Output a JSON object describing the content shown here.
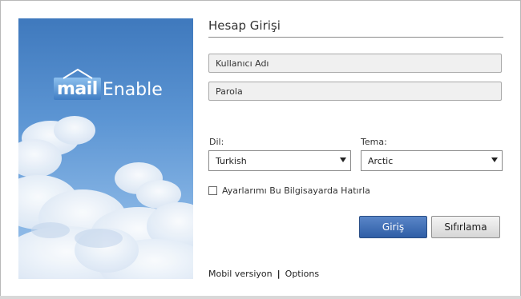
{
  "logo": {
    "part1": "mail",
    "part2": "Enable"
  },
  "form": {
    "title": "Hesap Girişi",
    "username_placeholder": "Kullanıcı Adı",
    "password_placeholder": "Parola",
    "language_label": "Dil:",
    "language_value": "Turkish",
    "theme_label": "Tema:",
    "theme_value": "Arctic",
    "remember_label": "Ayarlarımı Bu Bilgisayarda Hatırla",
    "login_button": "Giriş",
    "reset_button": "Sıfırlama"
  },
  "footer": {
    "mobile_link": "Mobil versiyon",
    "separator": "|",
    "options_link": "Options"
  },
  "colors": {
    "primary_button": "#2f5ea6",
    "sky": "#5d96d4"
  }
}
